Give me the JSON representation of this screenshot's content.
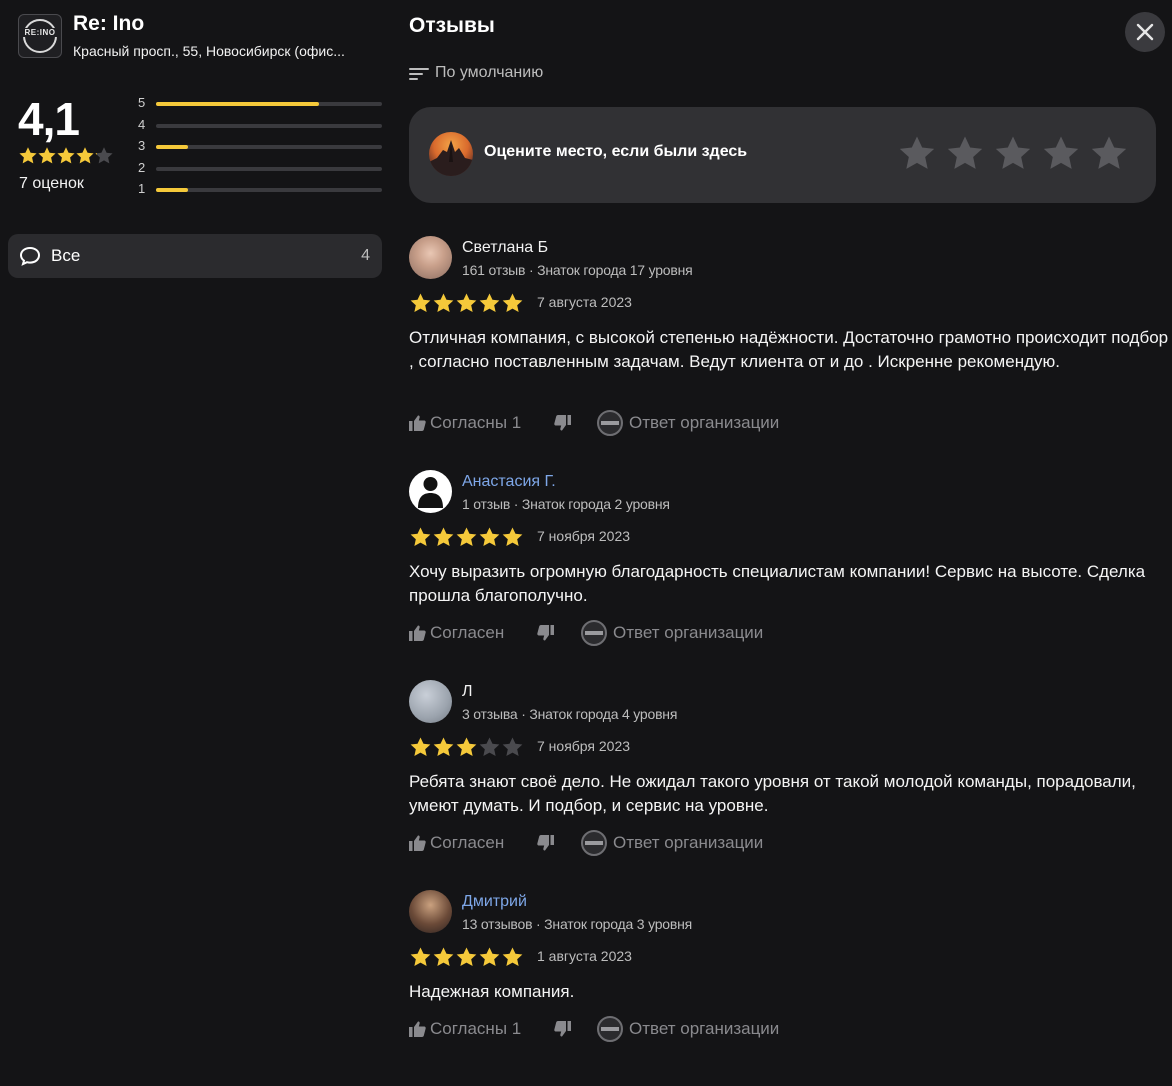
{
  "organization": {
    "name": "Re: Ino",
    "address": "Красный просп., 55, Новосибирск (офис...",
    "logo_text": "RE:INO"
  },
  "rating": {
    "value": "4,1",
    "stars_filled": 4.1,
    "count_label": "7 оценок",
    "distribution": [
      {
        "label": "5",
        "fraction": 0.72
      },
      {
        "label": "4",
        "fraction": 0.0
      },
      {
        "label": "3",
        "fraction": 0.14
      },
      {
        "label": "2",
        "fraction": 0.0
      },
      {
        "label": "1",
        "fraction": 0.14
      }
    ]
  },
  "filter": {
    "label": "Все",
    "count": "4"
  },
  "reviews_panel": {
    "title": "Отзывы",
    "sort_label": "По умолчанию",
    "rate_prompt": "Оцените место, если были здесь"
  },
  "reviews": [
    {
      "author": "Светлана Б",
      "author_link": false,
      "meta": "161 отзыв · Знаток города 17 уровня",
      "stars": 5,
      "date": "7 августа 2023",
      "text": "Отличная компания, с высокой степенью надёжности. Достаточно грамотно происходит подбор , согласно поставленным задачам. Ведут клиента от и до . Искренне рекомендую.",
      "agree": "Согласны 1",
      "org_reply": "Ответ организации"
    },
    {
      "author": "Анастасия Г.",
      "author_link": true,
      "meta": "1 отзыв · Знаток города 2 уровня",
      "stars": 5,
      "date": "7 ноября 2023",
      "text": "Хочу выразить огромную благодарность специалистам компании! Сервис на высоте. Сделка прошла благополучно.",
      "agree": "Согласен",
      "org_reply": "Ответ организации"
    },
    {
      "author": "Л",
      "author_link": false,
      "meta": "3 отзыва · Знаток города 4 уровня",
      "stars": 3,
      "date": "7 ноября 2023",
      "text": "Ребята знают своё дело. Не ожидал такого уровня от такой молодой команды, порадовали, умеют думать. И подбор, и сервис на уровне.",
      "agree": "Согласен",
      "org_reply": "Ответ организации"
    },
    {
      "author": "Дмитрий",
      "author_link": true,
      "meta": "13 отзывов · Знаток города 3 уровня",
      "stars": 5,
      "date": "1 августа 2023",
      "text": "Надежная компания.",
      "agree": "Согласны 1",
      "org_reply": "Ответ организации"
    }
  ],
  "colors": {
    "background": "#141416",
    "star_filled": "#f5c93a",
    "star_empty": "#4a4a4e",
    "link": "#7ea7e8",
    "muted": "#8a8a8e"
  },
  "icons": {
    "close": "close-icon",
    "sort": "sort-icon",
    "comment": "comment-bubble-icon",
    "like": "thumbs-up-icon",
    "dislike": "thumbs-down-icon"
  }
}
